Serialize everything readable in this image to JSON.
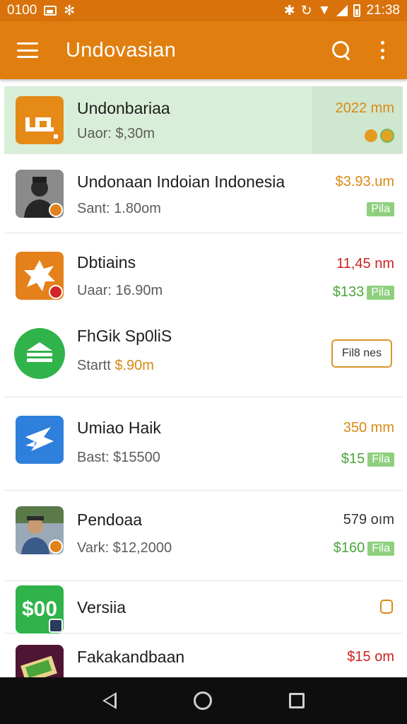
{
  "status_bar": {
    "time_left": "0100",
    "time_right": "21:38"
  },
  "app_bar": {
    "title": "Undovasian",
    "menu_icon": "hamburger-menu-icon",
    "search_icon": "search-icon",
    "more_icon": "more-vert-icon"
  },
  "colors": {
    "status_bar": "#d9720b",
    "app_bar": "#e07f10",
    "highlight_row": "#d8eed8",
    "price_green": "#4aa63a",
    "price_red": "#cc2222",
    "price_orange": "#d98a14"
  },
  "items": [
    {
      "title": "Undonbariaa",
      "subtitle": "Uaor: $,30m",
      "meta": "2022 mm"
    },
    {
      "title": "Undonaan Indoian Indonesia",
      "subtitle": "Sant: 1.80om",
      "meta": "$3.93.um",
      "pill": "Pila"
    },
    {
      "title": "Dbtiains",
      "subtitle": "Uaar: 16.90m",
      "meta": "11,45 nm",
      "tag_price": "$133",
      "pill": "Pila"
    },
    {
      "title": "FhGik Sp0liS",
      "subtitle_prefix": "Startt",
      "subtitle_value": "$.90m",
      "button": "Fil8 nes"
    },
    {
      "title": "Umiao Haik",
      "subtitle": "Bast: $15500",
      "meta": "350 mm",
      "tag_price": "$15",
      "pill": "Fila"
    },
    {
      "title": "Pendoaa",
      "subtitle": "Vark: $12,2000",
      "meta": "579 oım",
      "tag_price": "$160",
      "pill": "Fila"
    },
    {
      "title": "Versiia",
      "thumb_text": "$00"
    },
    {
      "title": "Fakakandbaan",
      "meta": "$15 om"
    }
  ]
}
